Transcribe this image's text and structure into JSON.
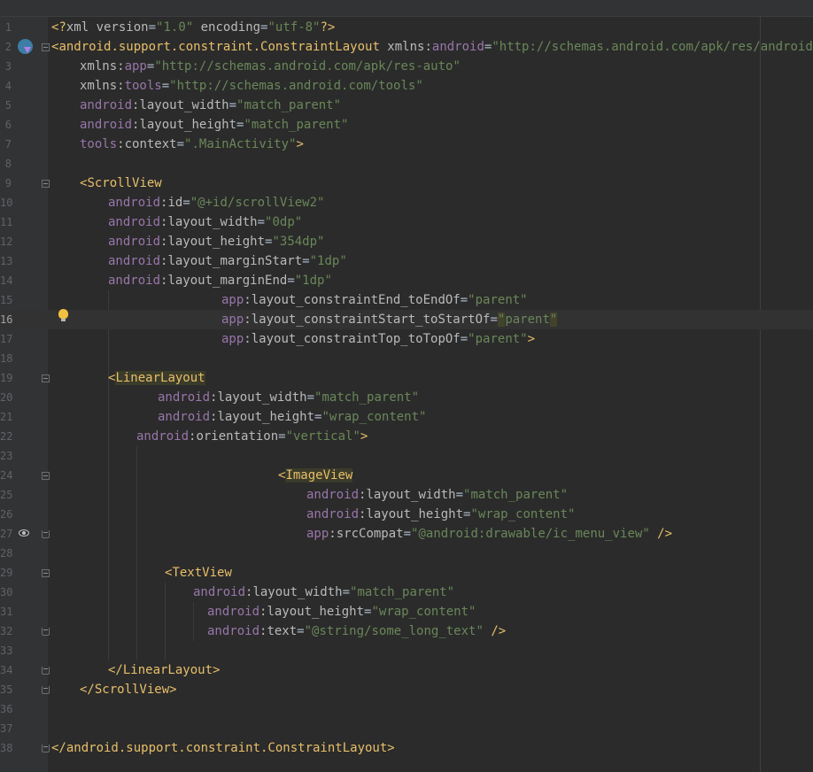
{
  "editor": {
    "language": "xml",
    "current_line": 16,
    "lines": [
      {
        "n": 1,
        "indent": 0,
        "tokens": [
          {
            "t": "<?",
            "c": "punct"
          },
          {
            "t": "xml ",
            "c": "attr"
          },
          {
            "t": "version",
            "c": "attr"
          },
          {
            "t": "=",
            "c": "eq"
          },
          {
            "t": "\"1.0\"",
            "c": "val"
          },
          {
            "t": " encoding",
            "c": "attr"
          },
          {
            "t": "=",
            "c": "eq"
          },
          {
            "t": "\"utf-8\"",
            "c": "val"
          },
          {
            "t": "?>",
            "c": "punct"
          }
        ]
      },
      {
        "n": 2,
        "indent": 0,
        "fold": "open",
        "tokens": [
          {
            "t": "<",
            "c": "punct"
          },
          {
            "t": "android.support.constraint.ConstraintLayout",
            "c": "tagname"
          },
          {
            "t": " xmlns:",
            "c": "attr"
          },
          {
            "t": "android",
            "c": "ns"
          },
          {
            "t": "=",
            "c": "eq"
          },
          {
            "t": "\"http://schemas.android.com/apk/res/android\"",
            "c": "val"
          }
        ]
      },
      {
        "n": 3,
        "indent": 32,
        "tokens": [
          {
            "t": "xmlns:",
            "c": "attr"
          },
          {
            "t": "app",
            "c": "ns"
          },
          {
            "t": "=",
            "c": "eq"
          },
          {
            "t": "\"http://schemas.android.com/apk/res-auto\"",
            "c": "val"
          }
        ]
      },
      {
        "n": 4,
        "indent": 32,
        "tokens": [
          {
            "t": "xmlns:",
            "c": "attr"
          },
          {
            "t": "tools",
            "c": "ns"
          },
          {
            "t": "=",
            "c": "eq"
          },
          {
            "t": "\"http://schemas.android.com/tools\"",
            "c": "val"
          }
        ]
      },
      {
        "n": 5,
        "indent": 32,
        "tokens": [
          {
            "t": "android",
            "c": "ns"
          },
          {
            "t": ":layout_width",
            "c": "attr"
          },
          {
            "t": "=",
            "c": "eq"
          },
          {
            "t": "\"match_parent\"",
            "c": "val"
          }
        ]
      },
      {
        "n": 6,
        "indent": 32,
        "tokens": [
          {
            "t": "android",
            "c": "ns"
          },
          {
            "t": ":layout_height",
            "c": "attr"
          },
          {
            "t": "=",
            "c": "eq"
          },
          {
            "t": "\"match_parent\"",
            "c": "val"
          }
        ]
      },
      {
        "n": 7,
        "indent": 32,
        "tokens": [
          {
            "t": "tools",
            "c": "ns"
          },
          {
            "t": ":context",
            "c": "attr"
          },
          {
            "t": "=",
            "c": "eq"
          },
          {
            "t": "\".MainActivity\"",
            "c": "val"
          },
          {
            "t": ">",
            "c": "punct"
          }
        ]
      },
      {
        "n": 8,
        "indent": 0,
        "tokens": []
      },
      {
        "n": 9,
        "indent": 32,
        "fold": "open",
        "tokens": [
          {
            "t": "<",
            "c": "punct"
          },
          {
            "t": "ScrollView",
            "c": "tagname"
          }
        ]
      },
      {
        "n": 10,
        "indent": 64,
        "tokens": [
          {
            "t": "android",
            "c": "ns"
          },
          {
            "t": ":id",
            "c": "attr"
          },
          {
            "t": "=",
            "c": "eq"
          },
          {
            "t": "\"@+id/scrollView2\"",
            "c": "val"
          }
        ]
      },
      {
        "n": 11,
        "indent": 64,
        "tokens": [
          {
            "t": "android",
            "c": "ns"
          },
          {
            "t": ":layout_width",
            "c": "attr"
          },
          {
            "t": "=",
            "c": "eq"
          },
          {
            "t": "\"0dp\"",
            "c": "val"
          }
        ]
      },
      {
        "n": 12,
        "indent": 64,
        "tokens": [
          {
            "t": "android",
            "c": "ns"
          },
          {
            "t": ":layout_height",
            "c": "attr"
          },
          {
            "t": "=",
            "c": "eq"
          },
          {
            "t": "\"354dp\"",
            "c": "val"
          }
        ]
      },
      {
        "n": 13,
        "indent": 64,
        "tokens": [
          {
            "t": "android",
            "c": "ns"
          },
          {
            "t": ":layout_marginStart",
            "c": "attr"
          },
          {
            "t": "=",
            "c": "eq"
          },
          {
            "t": "\"1dp\"",
            "c": "val"
          }
        ]
      },
      {
        "n": 14,
        "indent": 64,
        "tokens": [
          {
            "t": "android",
            "c": "ns"
          },
          {
            "t": ":layout_marginEnd",
            "c": "attr"
          },
          {
            "t": "=",
            "c": "eq"
          },
          {
            "t": "\"1dp\"",
            "c": "val"
          }
        ]
      },
      {
        "n": 15,
        "indent": 192,
        "tokens": [
          {
            "t": "app",
            "c": "ns"
          },
          {
            "t": ":layout_constraintEnd_toEndOf",
            "c": "attr"
          },
          {
            "t": "=",
            "c": "eq"
          },
          {
            "t": "\"parent\"",
            "c": "val"
          }
        ]
      },
      {
        "n": 16,
        "indent": 192,
        "tokens": [
          {
            "t": "app",
            "c": "ns"
          },
          {
            "t": ":layout_constraintStart_toStartOf",
            "c": "attr"
          },
          {
            "t": "=",
            "c": "eq"
          },
          {
            "t": "\"",
            "c": "caret"
          },
          {
            "t": "parent",
            "c": "val"
          },
          {
            "t": "\"",
            "c": "caret"
          }
        ]
      },
      {
        "n": 17,
        "indent": 192,
        "tokens": [
          {
            "t": "app",
            "c": "ns"
          },
          {
            "t": ":layout_constraintTop_toTopOf",
            "c": "attr"
          },
          {
            "t": "=",
            "c": "eq"
          },
          {
            "t": "\"parent\"",
            "c": "val"
          },
          {
            "t": ">",
            "c": "punct"
          }
        ]
      },
      {
        "n": 18,
        "indent": 0,
        "tokens": []
      },
      {
        "n": 19,
        "indent": 64,
        "fold": "open",
        "tokens": [
          {
            "t": "<",
            "c": "punct"
          },
          {
            "t": "LinearLayout",
            "c": "hl"
          }
        ]
      },
      {
        "n": 20,
        "indent": 120,
        "tokens": [
          {
            "t": "android",
            "c": "ns"
          },
          {
            "t": ":layout_width",
            "c": "attr"
          },
          {
            "t": "=",
            "c": "eq"
          },
          {
            "t": "\"match_parent\"",
            "c": "val"
          }
        ]
      },
      {
        "n": 21,
        "indent": 120,
        "tokens": [
          {
            "t": "android",
            "c": "ns"
          },
          {
            "t": ":layout_height",
            "c": "attr"
          },
          {
            "t": "=",
            "c": "eq"
          },
          {
            "t": "\"wrap_content\"",
            "c": "val"
          }
        ]
      },
      {
        "n": 22,
        "indent": 96,
        "tokens": [
          {
            "t": "android",
            "c": "ns"
          },
          {
            "t": ":orientation",
            "c": "attr"
          },
          {
            "t": "=",
            "c": "eq"
          },
          {
            "t": "\"vertical\"",
            "c": "val"
          },
          {
            "t": ">",
            "c": "punct"
          }
        ]
      },
      {
        "n": 23,
        "indent": 0,
        "tokens": []
      },
      {
        "n": 24,
        "indent": 256,
        "fold": "open",
        "tokens": [
          {
            "t": "<",
            "c": "punct"
          },
          {
            "t": "ImageView",
            "c": "hl"
          }
        ]
      },
      {
        "n": 25,
        "indent": 288,
        "tokens": [
          {
            "t": "android",
            "c": "ns"
          },
          {
            "t": ":layout_width",
            "c": "attr"
          },
          {
            "t": "=",
            "c": "eq"
          },
          {
            "t": "\"match_parent\"",
            "c": "val"
          }
        ]
      },
      {
        "n": 26,
        "indent": 288,
        "tokens": [
          {
            "t": "android",
            "c": "ns"
          },
          {
            "t": ":layout_height",
            "c": "attr"
          },
          {
            "t": "=",
            "c": "eq"
          },
          {
            "t": "\"wrap_content\"",
            "c": "val"
          }
        ]
      },
      {
        "n": 27,
        "indent": 288,
        "fold": "end",
        "tokens": [
          {
            "t": "app",
            "c": "ns"
          },
          {
            "t": ":srcCompat",
            "c": "attr"
          },
          {
            "t": "=",
            "c": "eq"
          },
          {
            "t": "\"@android:drawable/ic_menu_view\"",
            "c": "val"
          },
          {
            "t": " />",
            "c": "punct"
          }
        ]
      },
      {
        "n": 28,
        "indent": 0,
        "tokens": []
      },
      {
        "n": 29,
        "indent": 128,
        "fold": "open",
        "tokens": [
          {
            "t": "<",
            "c": "punct"
          },
          {
            "t": "TextView",
            "c": "tagname"
          }
        ]
      },
      {
        "n": 30,
        "indent": 160,
        "tokens": [
          {
            "t": "android",
            "c": "ns"
          },
          {
            "t": ":layout_width",
            "c": "attr"
          },
          {
            "t": "=",
            "c": "eq"
          },
          {
            "t": "\"match_parent\"",
            "c": "val"
          }
        ]
      },
      {
        "n": 31,
        "indent": 176,
        "tokens": [
          {
            "t": "android",
            "c": "ns"
          },
          {
            "t": ":layout_height",
            "c": "attr"
          },
          {
            "t": "=",
            "c": "eq"
          },
          {
            "t": "\"wrap_content\"",
            "c": "val"
          }
        ]
      },
      {
        "n": 32,
        "indent": 176,
        "fold": "end",
        "tokens": [
          {
            "t": "android",
            "c": "ns"
          },
          {
            "t": ":text",
            "c": "attr"
          },
          {
            "t": "=",
            "c": "eq"
          },
          {
            "t": "\"@string/some_long_text\"",
            "c": "val"
          },
          {
            "t": " />",
            "c": "punct"
          }
        ]
      },
      {
        "n": 33,
        "indent": 0,
        "tokens": []
      },
      {
        "n": 34,
        "indent": 64,
        "fold": "end",
        "tokens": [
          {
            "t": "</",
            "c": "punct"
          },
          {
            "t": "LinearLayout",
            "c": "tagname"
          },
          {
            "t": ">",
            "c": "punct"
          }
        ]
      },
      {
        "n": 35,
        "indent": 32,
        "fold": "end",
        "tokens": [
          {
            "t": "</",
            "c": "punct"
          },
          {
            "t": "ScrollView",
            "c": "tagname"
          },
          {
            "t": ">",
            "c": "punct"
          }
        ]
      },
      {
        "n": 36,
        "indent": 0,
        "tokens": []
      },
      {
        "n": 37,
        "indent": 0,
        "tokens": []
      },
      {
        "n": 38,
        "indent": 0,
        "fold": "end",
        "tokens": [
          {
            "t": "</",
            "c": "punct"
          },
          {
            "t": "android.support.constraint.ConstraintLayout",
            "c": "tagname"
          },
          {
            "t": ">",
            "c": "punct"
          }
        ]
      }
    ],
    "gutter_icons": [
      {
        "name": "android-activity-icon",
        "line": 2
      },
      {
        "name": "lightbulb-icon",
        "line": 16
      },
      {
        "name": "eye-icon",
        "line": 27
      }
    ],
    "colors": {
      "background": "#2b2b2b",
      "gutter": "#313335",
      "line_number": "#606366",
      "current_line": "#323232",
      "tag": "#e8bf6a",
      "attribute": "#bababa",
      "namespace": "#9876aa",
      "value": "#6a8759"
    }
  }
}
